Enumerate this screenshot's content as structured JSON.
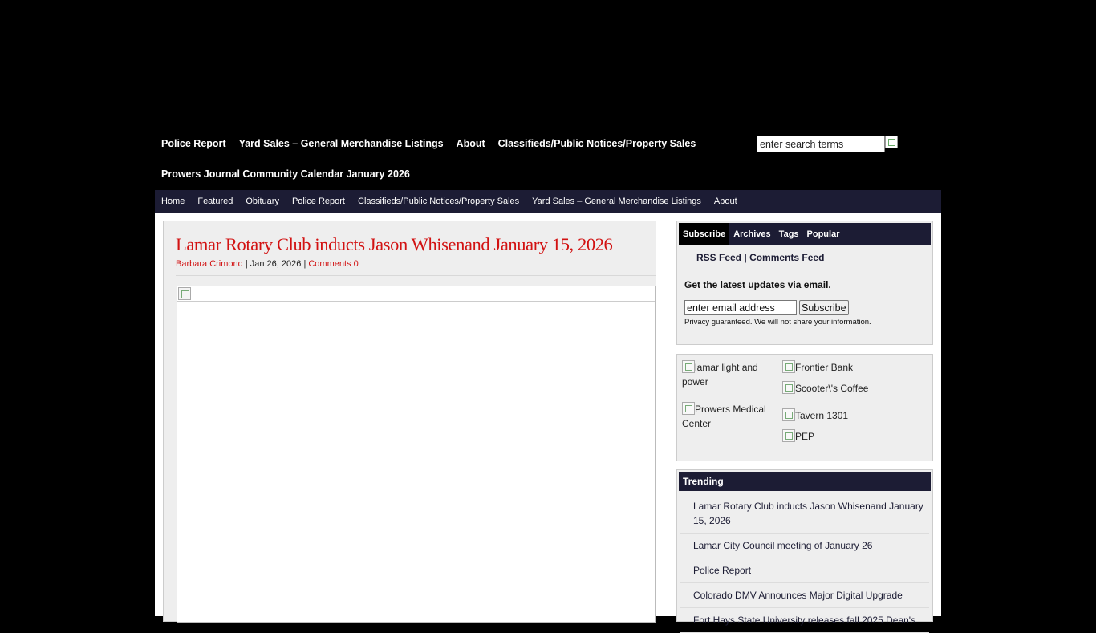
{
  "nav_primary": {
    "row1": [
      "Police Report",
      "Yard Sales – General Merchandise Listings",
      "About",
      "Classifieds/Public Notices/Property Sales"
    ],
    "row2": [
      "Prowers Journal Community Calendar January 2026"
    ]
  },
  "search": {
    "placeholder": "enter search terms",
    "value": "enter search terms"
  },
  "nav_categories": [
    "Home",
    "Featured",
    "Obituary",
    "Police Report",
    "Classifieds/Public Notices/Property Sales",
    "Yard Sales – General Merchandise Listings",
    "About"
  ],
  "post": {
    "title": "Lamar Rotary Club inducts Jason Whisenand January 15, 2026",
    "author": "Barbara Crimond",
    "date": "Jan 26, 2026",
    "comments": "Comments 0",
    "sep": "|"
  },
  "sidebar": {
    "tabs": [
      "Subscribe",
      "Archives",
      "Tags",
      "Popular"
    ],
    "active_tab": "Subscribe",
    "rss_feed": "RSS Feed",
    "feed_sep": "|",
    "comments_feed": "Comments Feed",
    "updates_label": "Get the latest updates via email.",
    "email_placeholder": "enter email address",
    "email_value": "enter email address",
    "subscribe_button": "Subscribe",
    "privacy_text": "Privacy guaranteed. We will not share your information."
  },
  "sponsors": [
    "lamar light and power",
    "Frontier Bank",
    "Scooter\\'s Coffee",
    "Prowers Medical Center",
    "Tavern 1301",
    "PEP"
  ],
  "trending": {
    "title": "Trending",
    "items": [
      "Lamar Rotary Club inducts Jason Whisenand January 15, 2026",
      "Lamar City Council meeting of January 26",
      "Police Report",
      "Colorado DMV Announces Major Digital Upgrade",
      "Fort Hays State University releases fall 2025 Dean's"
    ]
  },
  "colors": {
    "accent_red": "#d21212",
    "nav_navy": "#1c1c34",
    "panel_gray": "#eeeeee"
  }
}
